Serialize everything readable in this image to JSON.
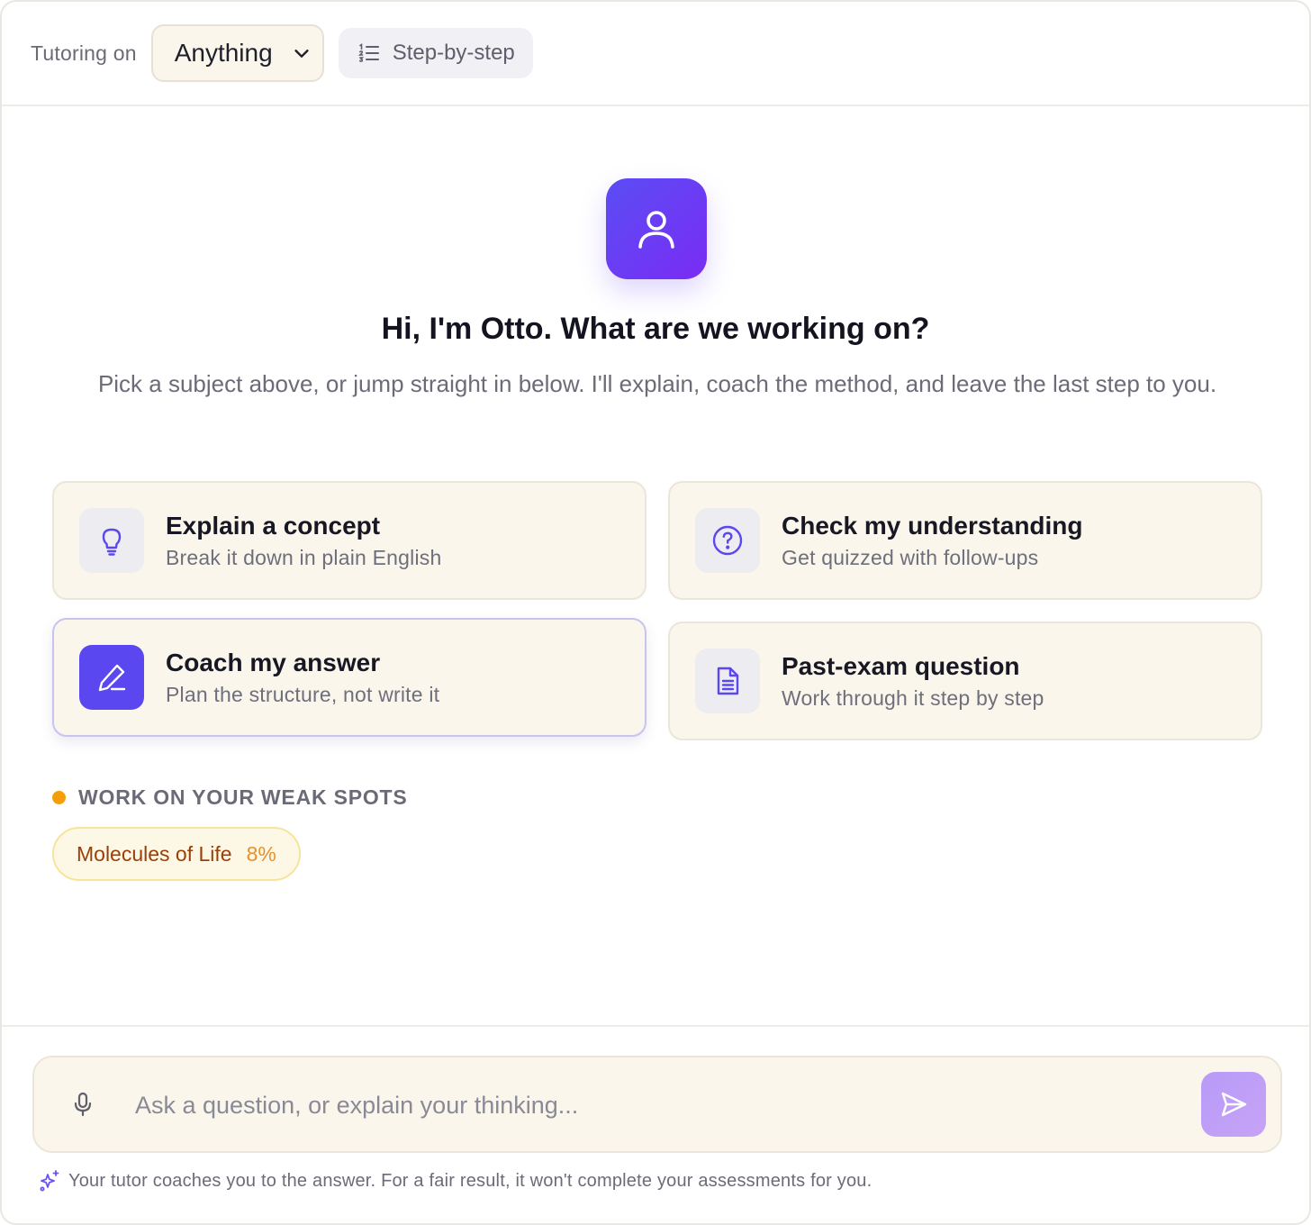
{
  "topbar": {
    "tutoring_label": "Tutoring on",
    "subject_selected": "Anything",
    "mode_label": "Step-by-step"
  },
  "hero": {
    "avatar_icon": "user-icon",
    "title": "Hi, I'm Otto. What are we working on?",
    "subtitle": "Pick a subject above, or jump straight in below. I'll explain, coach the method, and leave the last step to you."
  },
  "cards": [
    {
      "icon": "lightbulb-icon",
      "title": "Explain a concept",
      "desc": "Break it down in plain English",
      "selected": false
    },
    {
      "icon": "question-circle-icon",
      "title": "Check my understanding",
      "desc": "Get quizzed with follow-ups",
      "selected": false
    },
    {
      "icon": "pen-icon",
      "title": "Coach my answer",
      "desc": "Plan the structure, not write it",
      "selected": true
    },
    {
      "icon": "document-icon",
      "title": "Past-exam question",
      "desc": "Work through it step by step",
      "selected": false
    }
  ],
  "weak_spots": {
    "heading": "WORK ON YOUR WEAK SPOTS",
    "items": [
      {
        "name": "Molecules of Life",
        "score": "8%"
      }
    ]
  },
  "composer": {
    "placeholder": "Ask a question, or explain your thinking...",
    "value": ""
  },
  "footer": {
    "note": "Your tutor coaches you to the answer. For a fair result, it won't complete your assessments for you."
  },
  "colors": {
    "accent": "#5a47f0",
    "card_bg": "#faf6ec",
    "weak_dot": "#f59e0b",
    "weak_text": "#9a3f08",
    "weak_pct": "#e88f2c"
  }
}
